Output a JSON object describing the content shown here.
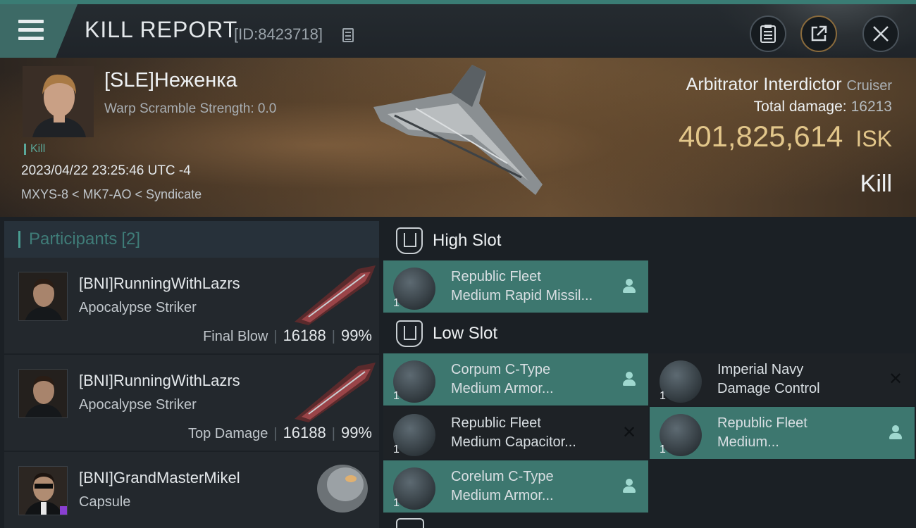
{
  "header": {
    "title": "KILL REPORT",
    "report_id": "[ID:8423718]",
    "menu_icon": "hamburger-menu-icon",
    "buttons": [
      {
        "name": "clipboard-icon"
      },
      {
        "name": "share-icon"
      },
      {
        "name": "close-icon"
      }
    ]
  },
  "victim": {
    "name": "[SLE]Неженка",
    "warp_scramble": "Warp Scramble Strength: 0.0",
    "tag": "Kill",
    "timestamp": "2023/04/22 23:25:46 UTC -4",
    "location": "MXYS-8 < MK7-AO < Syndicate",
    "ship_name": "Arbitrator Interdictor",
    "ship_class": "Cruiser",
    "total_damage_label": "Total damage:",
    "total_damage": "16213",
    "isk_value": "401,825,614",
    "isk_unit": "ISK",
    "result": "Kill"
  },
  "participants": {
    "label": "Participants",
    "count": "[2]",
    "rows": [
      {
        "name": "[BNI]RunningWithLazrs",
        "ship": "Apocalypse Striker",
        "role": "Final Blow",
        "damage": "16188",
        "percent": "99%"
      },
      {
        "name": "[BNI]RunningWithLazrs",
        "ship": "Apocalypse Striker",
        "role": "Top Damage",
        "damage": "16188",
        "percent": "99%"
      },
      {
        "name": "[BNI]GrandMasterMikel",
        "ship": "Capsule"
      }
    ]
  },
  "fitting": {
    "high_slot": {
      "title": "High Slot",
      "modules": [
        {
          "line1": "Republic Fleet",
          "line2": "Medium Rapid Missil...",
          "qty": "1",
          "status": "dropped"
        }
      ]
    },
    "low_slot": {
      "title": "Low Slot",
      "modules": [
        {
          "line1": "Corpum C-Type",
          "line2": "Medium Armor...",
          "qty": "1",
          "status": "dropped"
        },
        {
          "line1": "Imperial Navy",
          "line2": "Damage Control",
          "qty": "1",
          "status": "destroyed"
        },
        {
          "line1": "Republic Fleet",
          "line2": "Medium Capacitor...",
          "qty": "1",
          "status": "destroyed"
        },
        {
          "line1": "Republic Fleet",
          "line2": "Medium...",
          "qty": "1",
          "status": "dropped"
        },
        {
          "line1": "Corelum C-Type",
          "line2": "Medium Armor...",
          "qty": "1",
          "status": "dropped"
        }
      ]
    }
  }
}
